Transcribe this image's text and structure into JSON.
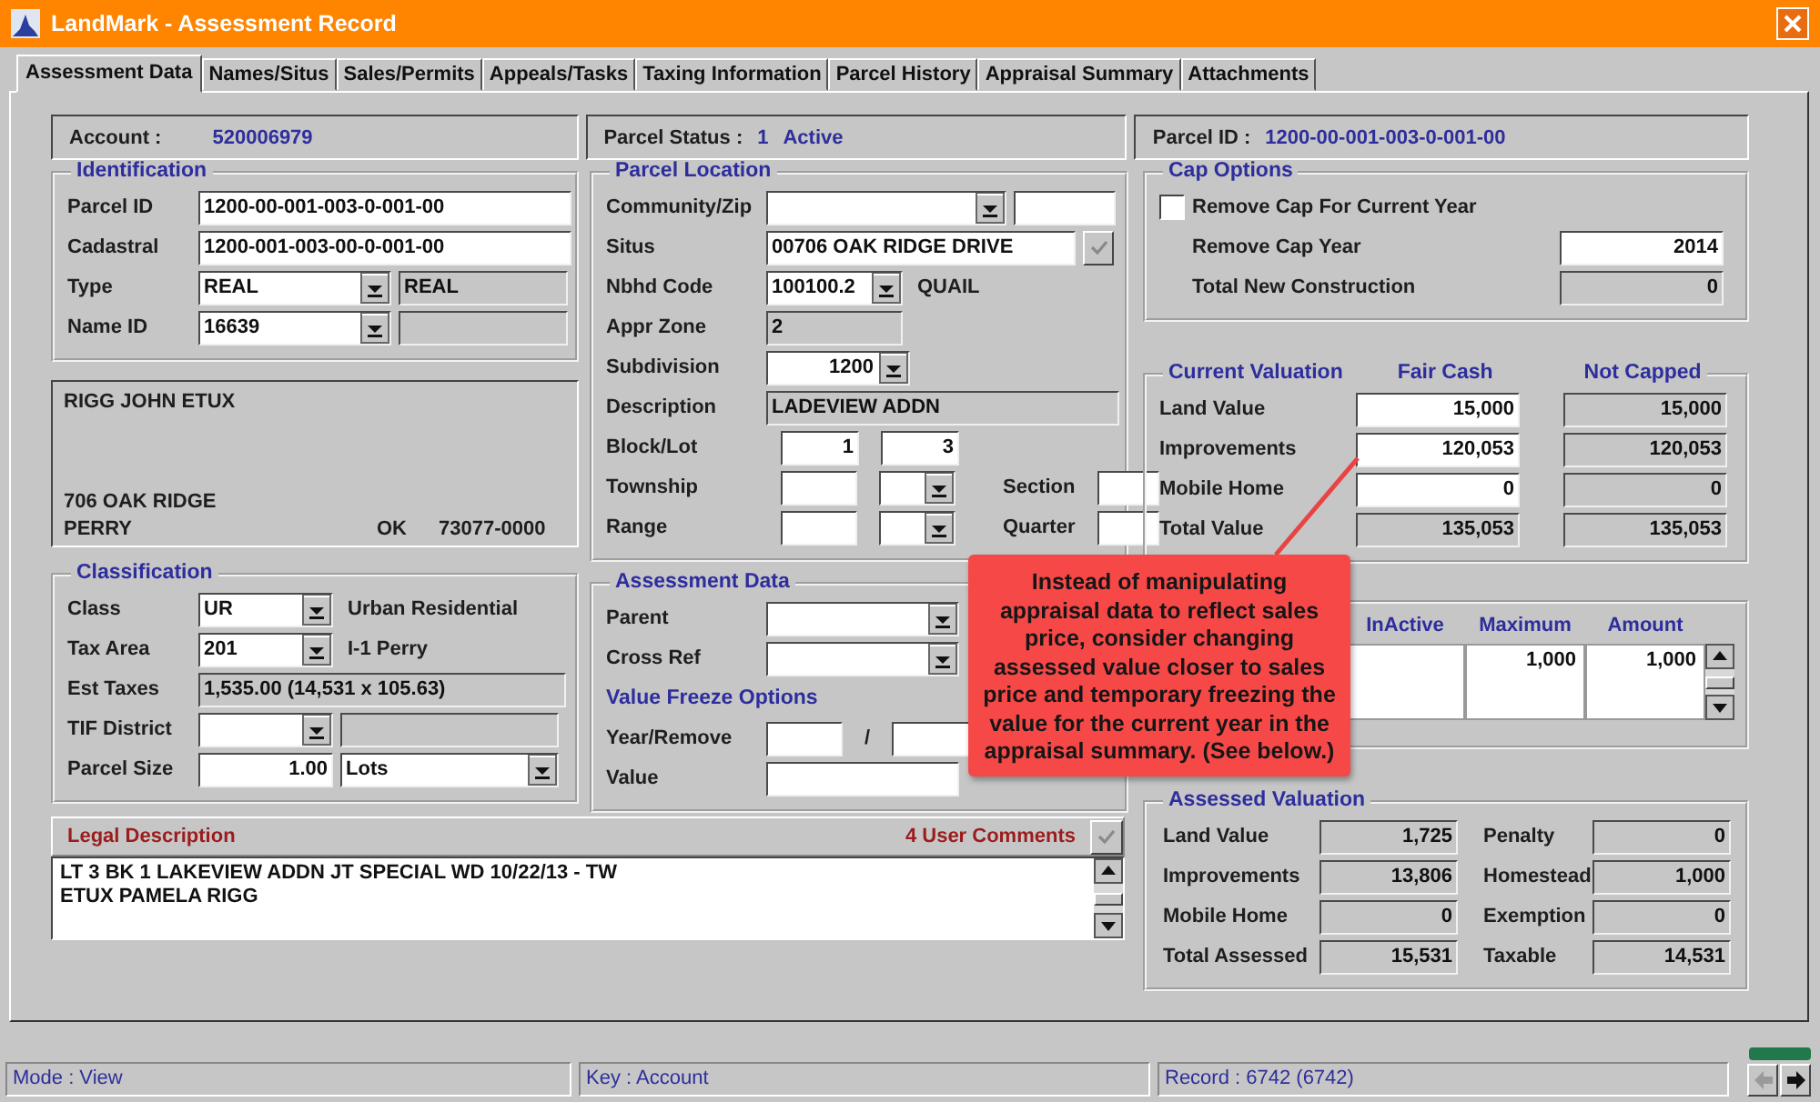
{
  "window": {
    "title": "LandMark - Assessment Record"
  },
  "tabs": [
    {
      "label": "Assessment Data",
      "selected": true
    },
    {
      "label": "Names/Situs",
      "selected": false
    },
    {
      "label": "Sales/Permits",
      "selected": false
    },
    {
      "label": "Appeals/Tasks",
      "selected": false
    },
    {
      "label": "Taxing Information",
      "selected": false
    },
    {
      "label": "Parcel History",
      "selected": false
    },
    {
      "label": "Appraisal Summary",
      "selected": false
    },
    {
      "label": "Attachments",
      "selected": false
    }
  ],
  "header": {
    "account": {
      "label": "Account :",
      "value": "520006979"
    },
    "parcel_status": {
      "label": "Parcel Status :",
      "code": "1",
      "value": "Active"
    },
    "parcel_id": {
      "label": "Parcel ID :",
      "value": "1200-00-001-003-0-001-00"
    }
  },
  "identification": {
    "title": "Identification",
    "rows": [
      {
        "label": "Parcel ID",
        "controls": [
          {
            "kind": "input",
            "value": "1200-00-001-003-0-001-00"
          }
        ]
      },
      {
        "label": "Cadastral",
        "controls": [
          {
            "kind": "input",
            "value": "1200-001-003-00-0-001-00"
          }
        ]
      },
      {
        "label": "Type",
        "controls": [
          {
            "kind": "select",
            "value": "REAL"
          },
          {
            "kind": "readonly",
            "value": "REAL"
          }
        ]
      },
      {
        "label": "Name ID",
        "controls": [
          {
            "kind": "select",
            "value": "16639"
          },
          {
            "kind": "readonly"
          }
        ]
      }
    ]
  },
  "owner": {
    "name": "RIGG JOHN ETUX",
    "address": "706 OAK RIDGE",
    "city": "PERRY",
    "state": "OK",
    "zip": "73077-0000"
  },
  "classification": {
    "title": "Classification",
    "rows": [
      {
        "label": "Class",
        "controls": [
          {
            "kind": "select",
            "value": "UR"
          },
          {
            "kind": "note",
            "value": "Urban Residential"
          }
        ]
      },
      {
        "label": "Tax Area",
        "controls": [
          {
            "kind": "select",
            "value": "201"
          },
          {
            "kind": "note",
            "value": "I-1 Perry"
          }
        ]
      },
      {
        "label": "Est Taxes",
        "controls": [
          {
            "kind": "readonly",
            "value": "1,535.00  (14,531 x 105.63)"
          }
        ]
      },
      {
        "label": "TIF District",
        "controls": [
          {
            "kind": "select"
          },
          {
            "kind": "readonly"
          }
        ]
      },
      {
        "label": "Parcel Size",
        "controls": [
          {
            "kind": "input-num",
            "value": "1.00"
          },
          {
            "kind": "select",
            "value": "Lots"
          }
        ]
      }
    ]
  },
  "parcel_location": {
    "title": "Parcel Location",
    "rows": [
      {
        "label": "Community/Zip",
        "controls": [
          {
            "kind": "select"
          },
          {
            "kind": "input"
          }
        ]
      },
      {
        "label": "Situs",
        "controls": [
          {
            "kind": "input",
            "value": "00706 OAK RIDGE DRIVE"
          },
          {
            "kind": "button"
          }
        ]
      },
      {
        "label": "Nbhd Code",
        "controls": [
          {
            "kind": "select",
            "value": "100100.2"
          },
          {
            "kind": "note",
            "value": "QUAIL"
          }
        ]
      },
      {
        "label": "Appr Zone",
        "controls": [
          {
            "kind": "readonly",
            "value": "2"
          }
        ]
      },
      {
        "label": "Subdivision",
        "controls": [
          {
            "kind": "select-num",
            "value": "1200"
          }
        ]
      },
      {
        "label": "Description",
        "controls": [
          {
            "kind": "readonly",
            "value": "LADEVIEW ADDN"
          }
        ]
      },
      {
        "label": "Block/Lot",
        "controls": [
          {
            "kind": "input-num",
            "value": "1"
          },
          {
            "kind": "input-num",
            "value": "3"
          }
        ]
      },
      {
        "label": "Township",
        "controls": [
          {
            "kind": "input"
          },
          {
            "kind": "select"
          },
          {
            "kind": "label",
            "value": "Section"
          },
          {
            "kind": "input"
          }
        ]
      },
      {
        "label": "Range",
        "controls": [
          {
            "kind": "input"
          },
          {
            "kind": "select"
          },
          {
            "kind": "label",
            "value": "Quarter"
          },
          {
            "kind": "input"
          }
        ]
      }
    ]
  },
  "assessment_data": {
    "title": "Assessment Data",
    "rows": [
      {
        "label": "Parent",
        "controls": [
          {
            "kind": "select"
          }
        ]
      },
      {
        "label": "Cross Ref",
        "controls": [
          {
            "kind": "select"
          }
        ]
      },
      {
        "heading": "Value Freeze Options"
      },
      {
        "label": "Year/Remove",
        "controls": [
          {
            "kind": "input"
          },
          {
            "kind": "slash",
            "value": "/"
          },
          {
            "kind": "input"
          }
        ]
      },
      {
        "label": "Value",
        "controls": [
          {
            "kind": "input"
          }
        ]
      }
    ]
  },
  "cap_options": {
    "title": "Cap Options",
    "checkbox": {
      "label": "Remove Cap For Current Year",
      "checked": false
    },
    "rows": [
      {
        "label": "Remove Cap Year",
        "controls": [
          {
            "kind": "input-num",
            "value": "2014"
          }
        ]
      },
      {
        "label": "Total New Construction",
        "controls": [
          {
            "kind": "readonly-num",
            "value": "0"
          }
        ]
      }
    ]
  },
  "current_valuation": {
    "title": "Current Valuation",
    "columns": [
      "Fair Cash",
      "Not Capped"
    ],
    "rows": [
      {
        "label": "Land Value",
        "controls": [
          {
            "kind": "input-num",
            "value": "15,000"
          },
          {
            "kind": "readonly-num",
            "value": "15,000"
          }
        ]
      },
      {
        "label": "Improvements",
        "controls": [
          {
            "kind": "input-num",
            "value": "120,053"
          },
          {
            "kind": "readonly-num",
            "value": "120,053"
          }
        ]
      },
      {
        "label": "Mobile Home",
        "controls": [
          {
            "kind": "input-num",
            "value": "0"
          },
          {
            "kind": "readonly-num",
            "value": "0"
          }
        ]
      },
      {
        "label": "Total Value",
        "controls": [
          {
            "kind": "readonly-num",
            "value": "135,053"
          },
          {
            "kind": "readonly-num",
            "value": "135,053"
          }
        ]
      }
    ]
  },
  "exemptions": {
    "columns": [
      "InActive",
      "Maximum",
      "Amount"
    ],
    "rows": [
      {
        "maximum": "1,000",
        "amount": "1,000"
      }
    ]
  },
  "assessed_valuation": {
    "title": "Assessed Valuation",
    "items": [
      {
        "label": "Land Value",
        "value": "1,725"
      },
      {
        "label": "Penalty",
        "value": "0"
      },
      {
        "label": "Improvements",
        "value": "13,806"
      },
      {
        "label": "Homestead",
        "value": "1,000"
      },
      {
        "label": "Mobile Home",
        "value": "0"
      },
      {
        "label": "Exemption",
        "value": "0"
      },
      {
        "label": "Total Assessed",
        "value": "15,531"
      },
      {
        "label": "Taxable",
        "value": "14,531"
      }
    ]
  },
  "legal_description": {
    "title": "Legal Description",
    "comments": "4 User Comments",
    "lines": [
      "LT 3 BK 1 LAKEVIEW ADDN JT SPECIAL WD 10/22/13 - TW",
      "ETUX PAMELA RIGG"
    ]
  },
  "callout": {
    "text": "Instead of manipulating appraisal data to reflect sales price, consider changing assessed value closer to sales price and temporary freezing the value for the current year in the appraisal summary. (See below.)"
  },
  "status_bar": {
    "mode": "Mode : View",
    "key": "Key : Account",
    "record": "Record : 6742 (6742)"
  },
  "progress": {
    "level": 1
  },
  "record_nav": [
    {
      "kind": "previous",
      "disabled": true
    },
    {
      "kind": "next",
      "disabled": false
    }
  ]
}
